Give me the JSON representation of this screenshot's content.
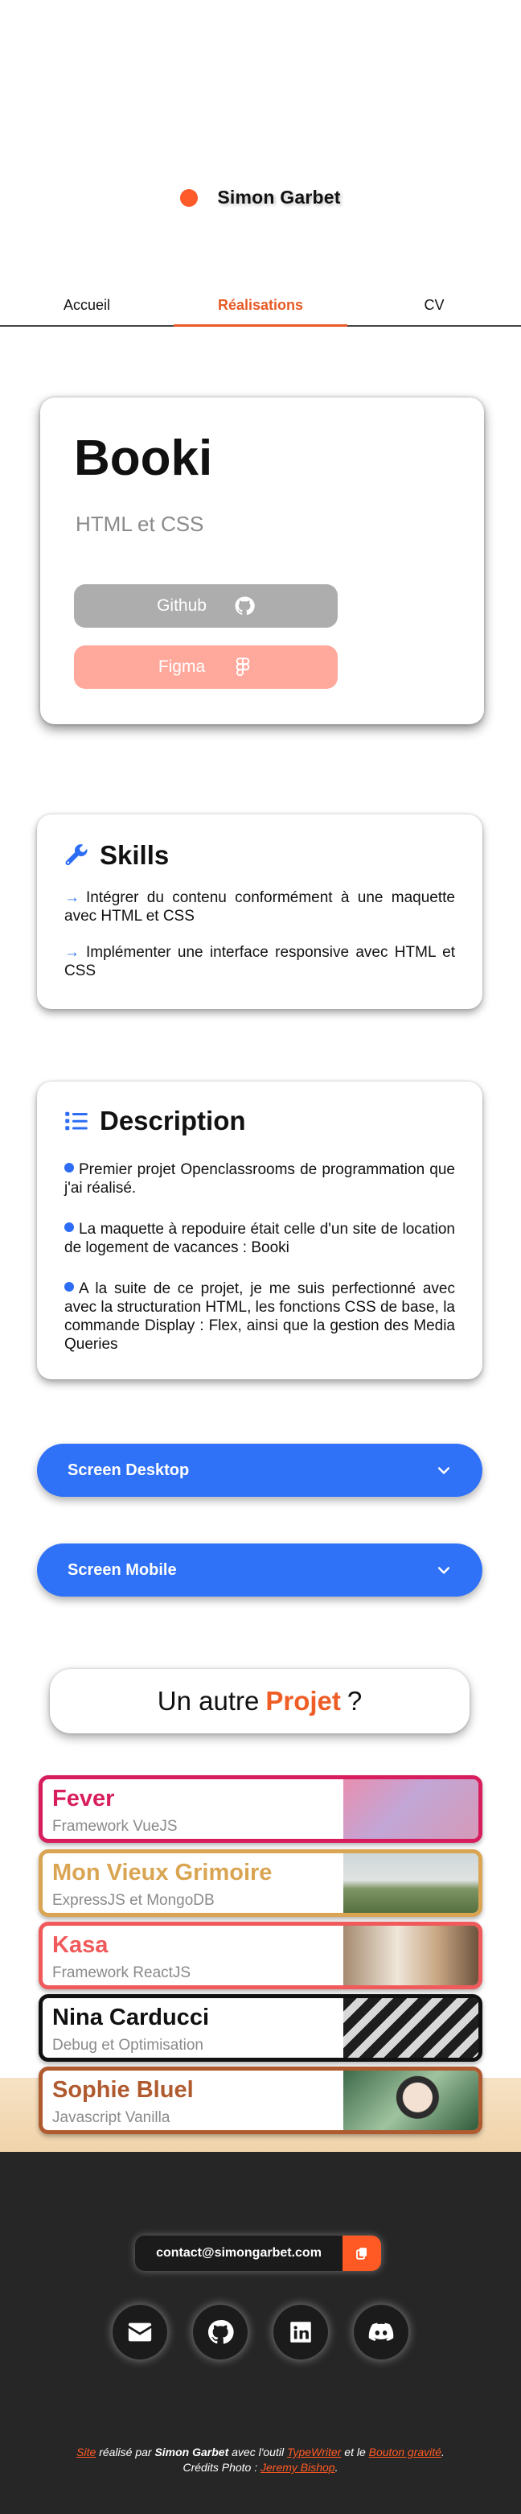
{
  "header": {
    "name": "Simon Garbet"
  },
  "nav": {
    "items": [
      "Accueil",
      "Réalisations",
      "CV"
    ],
    "active": "Réalisations"
  },
  "project": {
    "title": "Booki",
    "subtitle": "HTML et CSS",
    "github_label": "Github",
    "figma_label": "Figma"
  },
  "skills": {
    "title": "Skills",
    "items": [
      "Intégrer du contenu conformément à une maquette avec HTML et CSS",
      "Implémenter une interface responsive avec HTML et CSS"
    ]
  },
  "description": {
    "title": "Description",
    "items": [
      "Premier projet Openclassrooms de programmation que j'ai réalisé.",
      "La maquette à repoduire était celle d'un site de location de logement de vacances : Booki",
      "A la suite de ce projet, je me suis perfectionné avec avec la structuration HTML, les fonctions CSS de base, la commande Display : Flex, ainsi que la gestion des Media Queries"
    ]
  },
  "accordions": [
    "Screen Desktop",
    "Screen Mobile"
  ],
  "other": {
    "prefix": "Un autre",
    "accent": "Projet",
    "suffix": "?"
  },
  "projects": [
    {
      "name": "Fever",
      "tech": "Framework VueJS"
    },
    {
      "name": "Mon Vieux Grimoire",
      "tech": "ExpressJS et MongoDB"
    },
    {
      "name": "Kasa",
      "tech": "Framework ReactJS"
    },
    {
      "name": "Nina Carducci",
      "tech": "Debug et Optimisation"
    },
    {
      "name": "Sophie Bluel",
      "tech": "Javascript Vanilla"
    }
  ],
  "footer": {
    "email": "contact@simongarbet.com",
    "social_icons": [
      "envelope-icon",
      "github-icon",
      "linkedin-icon",
      "discord-icon"
    ],
    "credits": {
      "site": "Site",
      "made_by": "réalisé par",
      "author": "Simon Garbet",
      "with_tool": "avec l'outil",
      "tool": "TypeWriter",
      "and": "et le",
      "effect": "Bouton gravité",
      "photos_prefix": "Crédits Photo :",
      "photographer": "Jeremy Bishop"
    }
  },
  "colors": {
    "accent": "#ff5a2a",
    "blue": "#2f71f7",
    "footer": "#262626"
  }
}
